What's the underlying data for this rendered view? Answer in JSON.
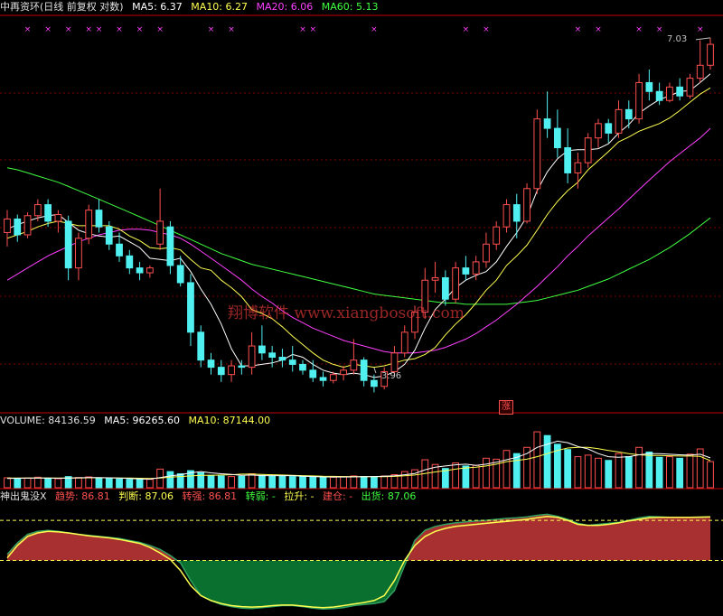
{
  "colors": {
    "up": "#ff5050",
    "down": "#50f0f0",
    "ma5": "#ffffff",
    "ma10": "#ffff50",
    "ma20": "#ff40ff",
    "ma60": "#40ff40",
    "grid": "#800000",
    "axis": "#c00000",
    "marker": "#ff40ff",
    "fill_up": "#a83030",
    "fill_down": "#0a7030",
    "watermark": "#ff4040"
  },
  "header": {
    "stock_name": "中再资环(日线 前复权 对数)",
    "ma5": "MA5: 6.37",
    "ma10": "MA10: 6.27",
    "ma20": "MA20: 6.06",
    "ma60": "MA60: 5.13"
  },
  "volume_header": {
    "volume": "VOLUME: 84136.59",
    "ma5": "MA5: 96265.60",
    "ma10": "MA10: 87144.00"
  },
  "indicator_header": {
    "name": "神出鬼没X",
    "trend": "趋势: 86.81",
    "judge": "判断: 87.06",
    "strong": "转强: 86.81",
    "weak": "转弱: -",
    "pull": "拉升: -",
    "build": "建仓: -",
    "exit": "出货: 87.06"
  },
  "watermark": "翔博软件 www.xiangbosoft.com",
  "badge": "涨",
  "chart_data": [
    {
      "type": "candlestick",
      "scale": "log",
      "ylim": [
        3.7,
        7.3
      ],
      "annotations": [
        {
          "label": "7.03",
          "value": 7.03,
          "index": 69
        },
        {
          "label": "3.96",
          "value": 3.96,
          "index": 36
        }
      ],
      "ohlc": [
        [
          5.0,
          5.2,
          4.88,
          5.12
        ],
        [
          5.12,
          5.16,
          4.92,
          4.98
        ],
        [
          4.98,
          5.18,
          4.95,
          5.15
        ],
        [
          5.15,
          5.3,
          5.1,
          5.25
        ],
        [
          5.25,
          5.3,
          5.05,
          5.1
        ],
        [
          5.1,
          5.2,
          5.0,
          5.16
        ],
        [
          5.1,
          5.15,
          4.6,
          4.7
        ],
        [
          4.7,
          5.0,
          4.6,
          4.95
        ],
        [
          4.95,
          5.25,
          4.9,
          5.2
        ],
        [
          5.2,
          5.3,
          5.0,
          5.05
        ],
        [
          5.05,
          5.1,
          4.85,
          4.9
        ],
        [
          4.9,
          5.0,
          4.75,
          4.8
        ],
        [
          4.8,
          4.85,
          4.65,
          4.7
        ],
        [
          4.7,
          4.75,
          4.6,
          4.66
        ],
        [
          4.66,
          4.72,
          4.62,
          4.7
        ],
        [
          4.9,
          5.4,
          4.85,
          5.1
        ],
        [
          5.05,
          5.1,
          4.65,
          4.72
        ],
        [
          4.72,
          4.8,
          4.55,
          4.58
        ],
        [
          4.58,
          4.65,
          4.1,
          4.2
        ],
        [
          4.2,
          4.25,
          3.95,
          4.0
        ],
        [
          4.0,
          4.05,
          3.9,
          3.95
        ],
        [
          3.95,
          4.0,
          3.85,
          3.9
        ],
        [
          3.9,
          4.0,
          3.85,
          3.96
        ],
        [
          3.96,
          4.0,
          3.9,
          3.95
        ],
        [
          3.95,
          4.2,
          3.9,
          4.1
        ],
        [
          4.1,
          4.25,
          4.0,
          4.05
        ],
        [
          4.05,
          4.1,
          3.95,
          4.02
        ],
        [
          4.02,
          4.08,
          3.95,
          4.0
        ],
        [
          4.0,
          4.1,
          3.92,
          3.97
        ],
        [
          3.97,
          4.0,
          3.9,
          3.93
        ],
        [
          3.93,
          4.0,
          3.85,
          3.88
        ],
        [
          3.88,
          3.92,
          3.82,
          3.86
        ],
        [
          3.86,
          3.92,
          3.84,
          3.9
        ],
        [
          3.9,
          3.96,
          3.86,
          3.93
        ],
        [
          3.93,
          4.15,
          3.9,
          4.0
        ],
        [
          4.0,
          4.02,
          3.82,
          3.86
        ],
        [
          3.86,
          3.9,
          3.78,
          3.82
        ],
        [
          3.82,
          3.95,
          3.8,
          3.92
        ],
        [
          3.92,
          4.1,
          3.9,
          4.05
        ],
        [
          4.05,
          4.25,
          4.02,
          4.2
        ],
        [
          4.2,
          4.4,
          4.15,
          4.35
        ],
        [
          4.35,
          4.7,
          4.3,
          4.6
        ],
        [
          4.6,
          4.75,
          4.5,
          4.62
        ],
        [
          4.62,
          4.68,
          4.4,
          4.45
        ],
        [
          4.45,
          4.75,
          4.42,
          4.7
        ],
        [
          4.7,
          4.8,
          4.6,
          4.65
        ],
        [
          4.65,
          4.8,
          4.6,
          4.75
        ],
        [
          4.75,
          5.0,
          4.7,
          4.9
        ],
        [
          4.9,
          5.1,
          4.85,
          5.05
        ],
        [
          5.05,
          5.3,
          5.0,
          5.25
        ],
        [
          5.25,
          5.35,
          4.95,
          5.1
        ],
        [
          5.1,
          5.45,
          5.08,
          5.4
        ],
        [
          5.4,
          6.2,
          5.35,
          6.1
        ],
        [
          6.1,
          6.4,
          5.9,
          6.0
        ],
        [
          6.0,
          6.2,
          5.7,
          5.8
        ],
        [
          5.8,
          6.0,
          5.45,
          5.55
        ],
        [
          5.55,
          5.75,
          5.4,
          5.65
        ],
        [
          5.65,
          5.95,
          5.6,
          5.9
        ],
        [
          5.9,
          6.1,
          5.8,
          6.05
        ],
        [
          6.05,
          6.1,
          5.85,
          5.95
        ],
        [
          5.95,
          6.3,
          5.9,
          6.2
        ],
        [
          6.2,
          6.3,
          6.0,
          6.1
        ],
        [
          6.1,
          6.6,
          6.05,
          6.5
        ],
        [
          6.5,
          6.65,
          6.3,
          6.4
        ],
        [
          6.4,
          6.5,
          6.25,
          6.3
        ],
        [
          6.3,
          6.5,
          6.28,
          6.45
        ],
        [
          6.45,
          6.55,
          6.3,
          6.35
        ],
        [
          6.35,
          6.6,
          6.32,
          6.55
        ],
        [
          6.55,
          7.0,
          6.5,
          6.7
        ],
        [
          6.7,
          7.03,
          6.65,
          6.95
        ]
      ],
      "ma5": [
        5.03,
        5.07,
        5.1,
        5.13,
        5.15,
        5.16,
        5.09,
        5.02,
        4.99,
        4.97,
        4.96,
        4.97,
        4.92,
        4.87,
        4.78,
        4.77,
        4.76,
        4.78,
        4.67,
        4.53,
        4.41,
        4.26,
        4.08,
        3.96,
        3.96,
        3.97,
        3.98,
        4.0,
        4.04,
        4.02,
        3.97,
        3.93,
        3.91,
        3.9,
        3.91,
        3.9,
        3.88,
        3.89,
        3.92,
        3.97,
        4.07,
        4.23,
        4.37,
        4.45,
        4.54,
        4.6,
        4.64,
        4.67,
        4.75,
        4.88,
        5.0,
        5.14,
        5.38,
        5.56,
        5.69,
        5.77,
        5.78,
        5.78,
        5.79,
        5.84,
        5.95,
        6.04,
        6.16,
        6.24,
        6.31,
        6.35,
        6.4,
        6.41,
        6.5,
        6.6
      ],
      "ma10": [
        4.95,
        4.98,
        5.01,
        5.05,
        5.08,
        5.1,
        5.08,
        5.06,
        5.06,
        5.06,
        5.06,
        5.03,
        4.97,
        4.93,
        4.87,
        4.86,
        4.87,
        4.85,
        4.77,
        4.7,
        4.68,
        4.6,
        4.54,
        4.47,
        4.37,
        4.34,
        4.3,
        4.24,
        4.17,
        4.11,
        4.05,
        4.0,
        3.97,
        3.95,
        3.97,
        3.96,
        3.95,
        3.96,
        3.98,
        4.0,
        4.01,
        4.04,
        4.09,
        4.18,
        4.26,
        4.33,
        4.42,
        4.52,
        4.6,
        4.72,
        4.8,
        4.89,
        5.02,
        5.16,
        5.28,
        5.38,
        5.46,
        5.58,
        5.67,
        5.76,
        5.86,
        5.91,
        5.97,
        6.01,
        6.05,
        6.11,
        6.19,
        6.28,
        6.37,
        6.44
      ],
      "ma20": [
        4.6,
        4.65,
        4.7,
        4.75,
        4.8,
        4.84,
        4.88,
        4.92,
        4.95,
        4.98,
        5.0,
        5.02,
        5.03,
        5.03,
        5.02,
        5.0,
        4.98,
        4.95,
        4.9,
        4.84,
        4.78,
        4.72,
        4.66,
        4.6,
        4.53,
        4.47,
        4.42,
        4.36,
        4.31,
        4.27,
        4.23,
        4.2,
        4.17,
        4.14,
        4.12,
        4.1,
        4.08,
        4.06,
        4.05,
        4.05,
        4.05,
        4.06,
        4.07,
        4.09,
        4.12,
        4.15,
        4.19,
        4.24,
        4.29,
        4.35,
        4.41,
        4.48,
        4.55,
        4.63,
        4.71,
        4.8,
        4.88,
        4.97,
        5.05,
        5.13,
        5.21,
        5.3,
        5.39,
        5.48,
        5.57,
        5.66,
        5.74,
        5.82,
        5.9,
        6.0
      ],
      "ma60": [
        5.6,
        5.58,
        5.55,
        5.52,
        5.49,
        5.46,
        5.42,
        5.38,
        5.34,
        5.3,
        5.26,
        5.22,
        5.18,
        5.14,
        5.1,
        5.06,
        5.02,
        4.98,
        4.94,
        4.9,
        4.86,
        4.82,
        4.79,
        4.76,
        4.73,
        4.71,
        4.69,
        4.67,
        4.65,
        4.63,
        4.61,
        4.59,
        4.57,
        4.55,
        4.53,
        4.51,
        4.49,
        4.48,
        4.47,
        4.46,
        4.45,
        4.44,
        4.43,
        4.42,
        4.42,
        4.41,
        4.41,
        4.41,
        4.41,
        4.41,
        4.42,
        4.43,
        4.44,
        4.46,
        4.48,
        4.5,
        4.52,
        4.55,
        4.58,
        4.61,
        4.65,
        4.69,
        4.73,
        4.77,
        4.82,
        4.87,
        4.93,
        4.99,
        5.06,
        5.13
      ]
    },
    {
      "type": "bar",
      "title": "VOLUME",
      "values": [
        32000,
        30000,
        31000,
        34000,
        30000,
        29000,
        36000,
        33000,
        35000,
        31000,
        29000,
        28000,
        27000,
        26000,
        27000,
        60000,
        52000,
        45000,
        55000,
        48000,
        40000,
        38000,
        36000,
        37000,
        45000,
        40000,
        38000,
        37000,
        36000,
        35000,
        34000,
        33000,
        34000,
        36000,
        38000,
        36000,
        35000,
        38000,
        42000,
        52000,
        58000,
        90000,
        75000,
        62000,
        80000,
        70000,
        72000,
        95000,
        92000,
        120000,
        110000,
        130000,
        180000,
        168000,
        140000,
        123000,
        100000,
        105000,
        95000,
        88000,
        110000,
        100000,
        130000,
        115000,
        98000,
        100000,
        95000,
        108000,
        125000,
        84136.59
      ],
      "ma5": [
        30000,
        30500,
        31000,
        31500,
        31000,
        30500,
        31500,
        32000,
        33000,
        33000,
        32000,
        31000,
        30000,
        28500,
        27500,
        33000,
        38000,
        42000,
        48000,
        52000,
        48000,
        45000,
        43000,
        40000,
        41000,
        39000,
        39000,
        39000,
        39000,
        37000,
        36000,
        35000,
        34500,
        34500,
        35000,
        35500,
        36000,
        37000,
        38500,
        42000,
        46000,
        58000,
        66000,
        70000,
        74000,
        76000,
        72000,
        76000,
        82000,
        90000,
        98000,
        110000,
        130000,
        140000,
        150000,
        145000,
        133000,
        125000,
        110000,
        100000,
        98000,
        100000,
        106000,
        110000,
        110000,
        108000,
        106000,
        105000,
        108000,
        96265.6
      ],
      "ma10": [
        31000,
        31000,
        31000,
        31000,
        31000,
        31000,
        31000,
        31500,
        32000,
        32000,
        32000,
        31500,
        31000,
        30500,
        30000,
        31500,
        34000,
        36000,
        38000,
        40000,
        40000,
        41000,
        42000,
        44000,
        44000,
        43000,
        42000,
        41000,
        40000,
        39000,
        38000,
        37000,
        36500,
        36000,
        36000,
        35500,
        35500,
        35800,
        36500,
        38500,
        41000,
        46000,
        51000,
        55000,
        60000,
        64000,
        66000,
        70000,
        76000,
        84000,
        88000,
        92000,
        100000,
        110000,
        120000,
        128000,
        130000,
        130000,
        126000,
        120000,
        115000,
        110000,
        106000,
        104000,
        104000,
        103000,
        102000,
        102000,
        101000,
        87144
      ]
    },
    {
      "type": "area",
      "title": "神出鬼没X",
      "trend_values": [
        12,
        35,
        52,
        58,
        60,
        58,
        55,
        52,
        50,
        48,
        46,
        44,
        40,
        36,
        30,
        22,
        10,
        -5,
        -40,
        -70,
        -80,
        -88,
        -92,
        -95,
        -96,
        -94,
        -92,
        -90,
        -90,
        -92,
        -95,
        -97,
        -96,
        -94,
        -90,
        -88,
        -86,
        -82,
        -60,
        -10,
        40,
        60,
        68,
        72,
        75,
        77,
        79,
        80,
        82,
        84,
        85,
        87,
        90,
        92,
        88,
        82,
        74,
        70,
        72,
        74,
        76,
        80,
        85,
        88,
        87,
        86,
        86,
        86,
        86,
        86.81
      ],
      "judge_values": [
        5,
        30,
        48,
        55,
        58,
        57,
        55,
        52,
        49,
        47,
        45,
        42,
        38,
        34,
        26,
        15,
        2,
        -20,
        -50,
        -70,
        -80,
        -86,
        -90,
        -92,
        -93,
        -92,
        -90,
        -89,
        -89,
        -91,
        -93,
        -94,
        -93,
        -90,
        -87,
        -84,
        -80,
        -70,
        -40,
        0,
        30,
        48,
        58,
        64,
        68,
        70,
        72,
        74,
        76,
        78,
        80,
        82,
        85,
        88,
        86,
        80,
        72,
        70,
        70,
        72,
        75,
        79,
        82,
        85,
        86,
        86,
        86,
        86,
        86.5,
        87.06
      ],
      "ylim": [
        -100,
        100
      ],
      "upper_line": 80,
      "lower_line": 0
    }
  ]
}
